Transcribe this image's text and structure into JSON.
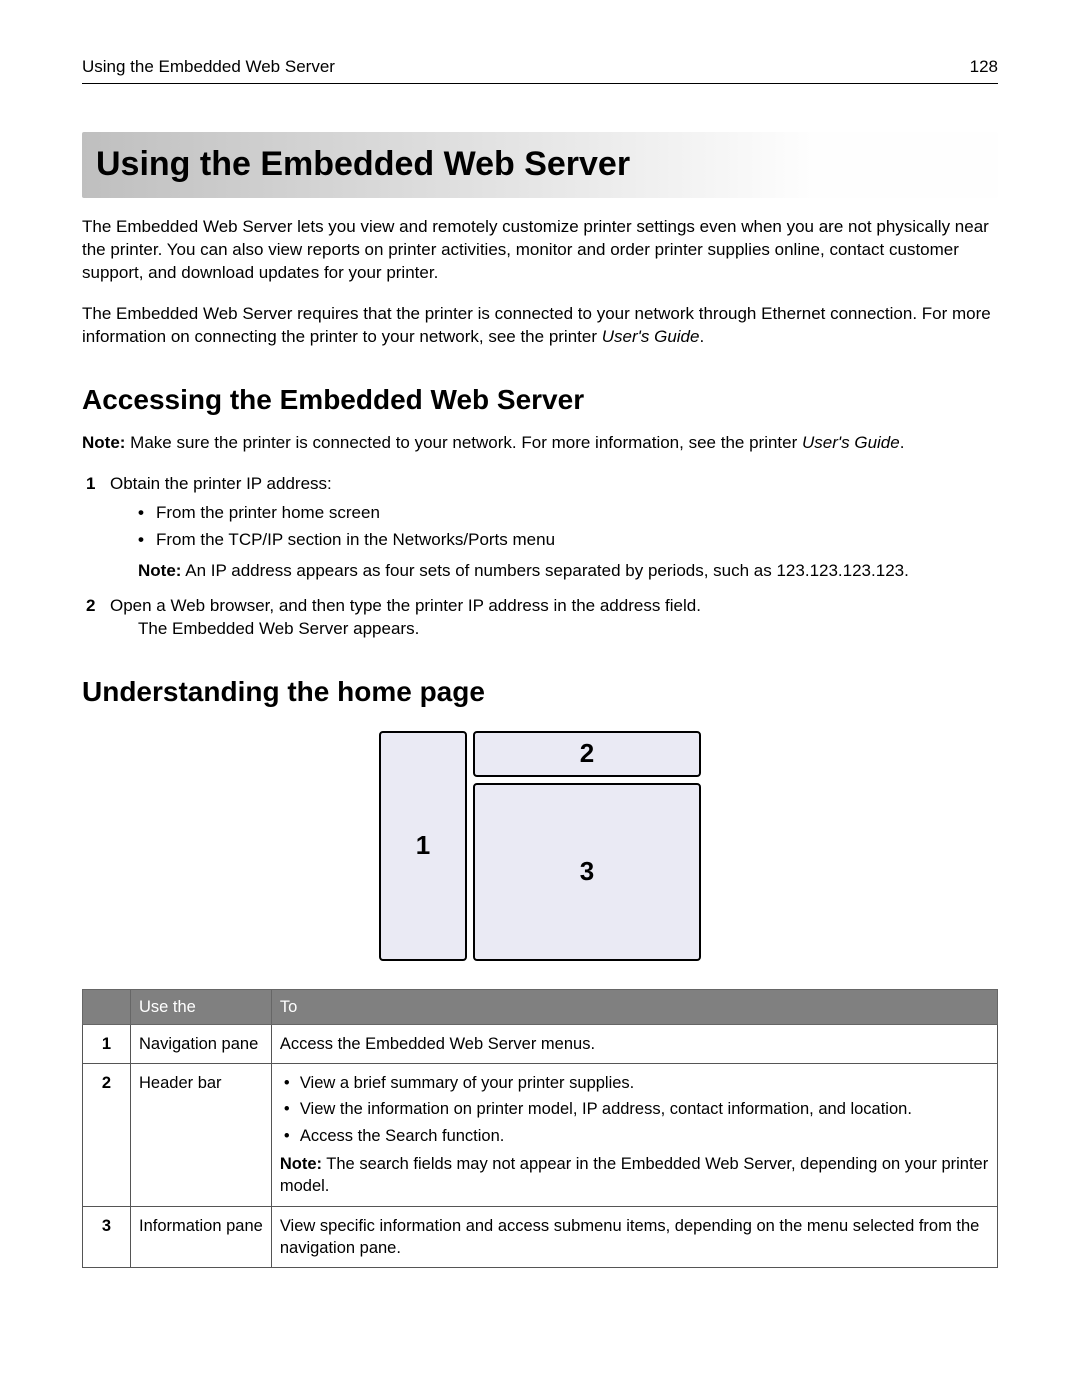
{
  "header": {
    "running_title": "Using the Embedded Web Server",
    "page_number": "128"
  },
  "title": "Using the Embedded Web Server",
  "intro_p1": "The Embedded Web Server lets you view and remotely customize printer settings even when you are not physically near the printer. You can also view reports on printer activities, monitor and order printer supplies online, contact customer support, and download updates for your printer.",
  "intro_p2_a": "The Embedded Web Server requires that the printer is connected to your network through Ethernet connection. For more information on connecting the printer to your network, see the printer ",
  "intro_p2_italic": "User's Guide",
  "intro_p2_b": ".",
  "section_accessing": {
    "heading": "Accessing the Embedded Web Server",
    "note_label": "Note:",
    "note_text_a": " Make sure the printer is connected to your network. For more information, see the printer ",
    "note_italic": "User's Guide",
    "note_text_b": ".",
    "step1": {
      "num": "1",
      "text": "Obtain the printer IP address:",
      "bullets": [
        "From the printer home screen",
        "From the TCP/IP section in the Networks/Ports menu"
      ],
      "subnote_label": "Note:",
      "subnote_text": " An IP address appears as four sets of numbers separated by periods, such as 123.123.123.123."
    },
    "step2": {
      "num": "2",
      "text": "Open a Web browser, and then type the printer IP address in the address field.",
      "sub": "The Embedded Web Server appears."
    }
  },
  "section_home": {
    "heading": "Understanding the home page",
    "diagram": {
      "label1": "1",
      "label2": "2",
      "label3": "3"
    },
    "table": {
      "headers": {
        "col1": "",
        "col2": "Use the",
        "col3": "To"
      },
      "rows": [
        {
          "idx": "1",
          "use": "Navigation pane",
          "to_text": "Access the Embedded Web Server menus."
        },
        {
          "idx": "2",
          "use": "Header bar",
          "bullets": [
            "View a brief summary of your printer supplies.",
            "View the information on printer model, IP address, contact information, and location.",
            "Access the Search function."
          ],
          "note_label": "Note:",
          "note_text": " The search fields may not appear in the Embedded Web Server, depending on your printer model."
        },
        {
          "idx": "3",
          "use": "Information pane",
          "to_text": "View specific information and access submenu items, depending on the menu selected from the navigation pane."
        }
      ]
    }
  }
}
